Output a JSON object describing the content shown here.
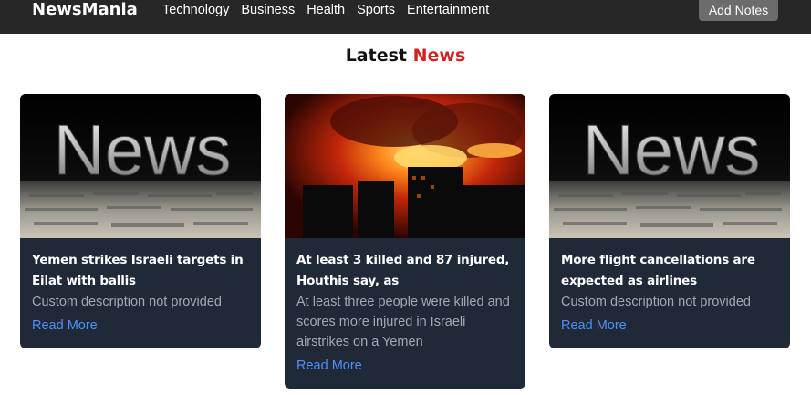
{
  "nav": {
    "brand": "NewsMania",
    "links": [
      "Technology",
      "Business",
      "Health",
      "Sports",
      "Entertainment"
    ],
    "add_notes_label": "Add Notes"
  },
  "heading": {
    "prefix": "Latest",
    "accent": "News"
  },
  "cards": [
    {
      "title": "Yemen strikes Israeli targets in Eilat with ballis",
      "description": "Custom description not provided",
      "link_label": "Read More",
      "image_caption": "News"
    },
    {
      "title": "At least 3 killed and 87 injured, Houthis say, as",
      "description": "At least three people were killed and scores more injured in Israeli airstrikes on a Yemen",
      "link_label": "Read More",
      "image_caption": ""
    },
    {
      "title": "More flight cancellations are expected as airlines",
      "description": "Custom description not provided",
      "link_label": "Read More",
      "image_caption": "News"
    }
  ],
  "colors": {
    "navbar": "#272727",
    "accent": "#d42020",
    "card_bg": "#1f2937",
    "link": "#4f8ff7"
  }
}
